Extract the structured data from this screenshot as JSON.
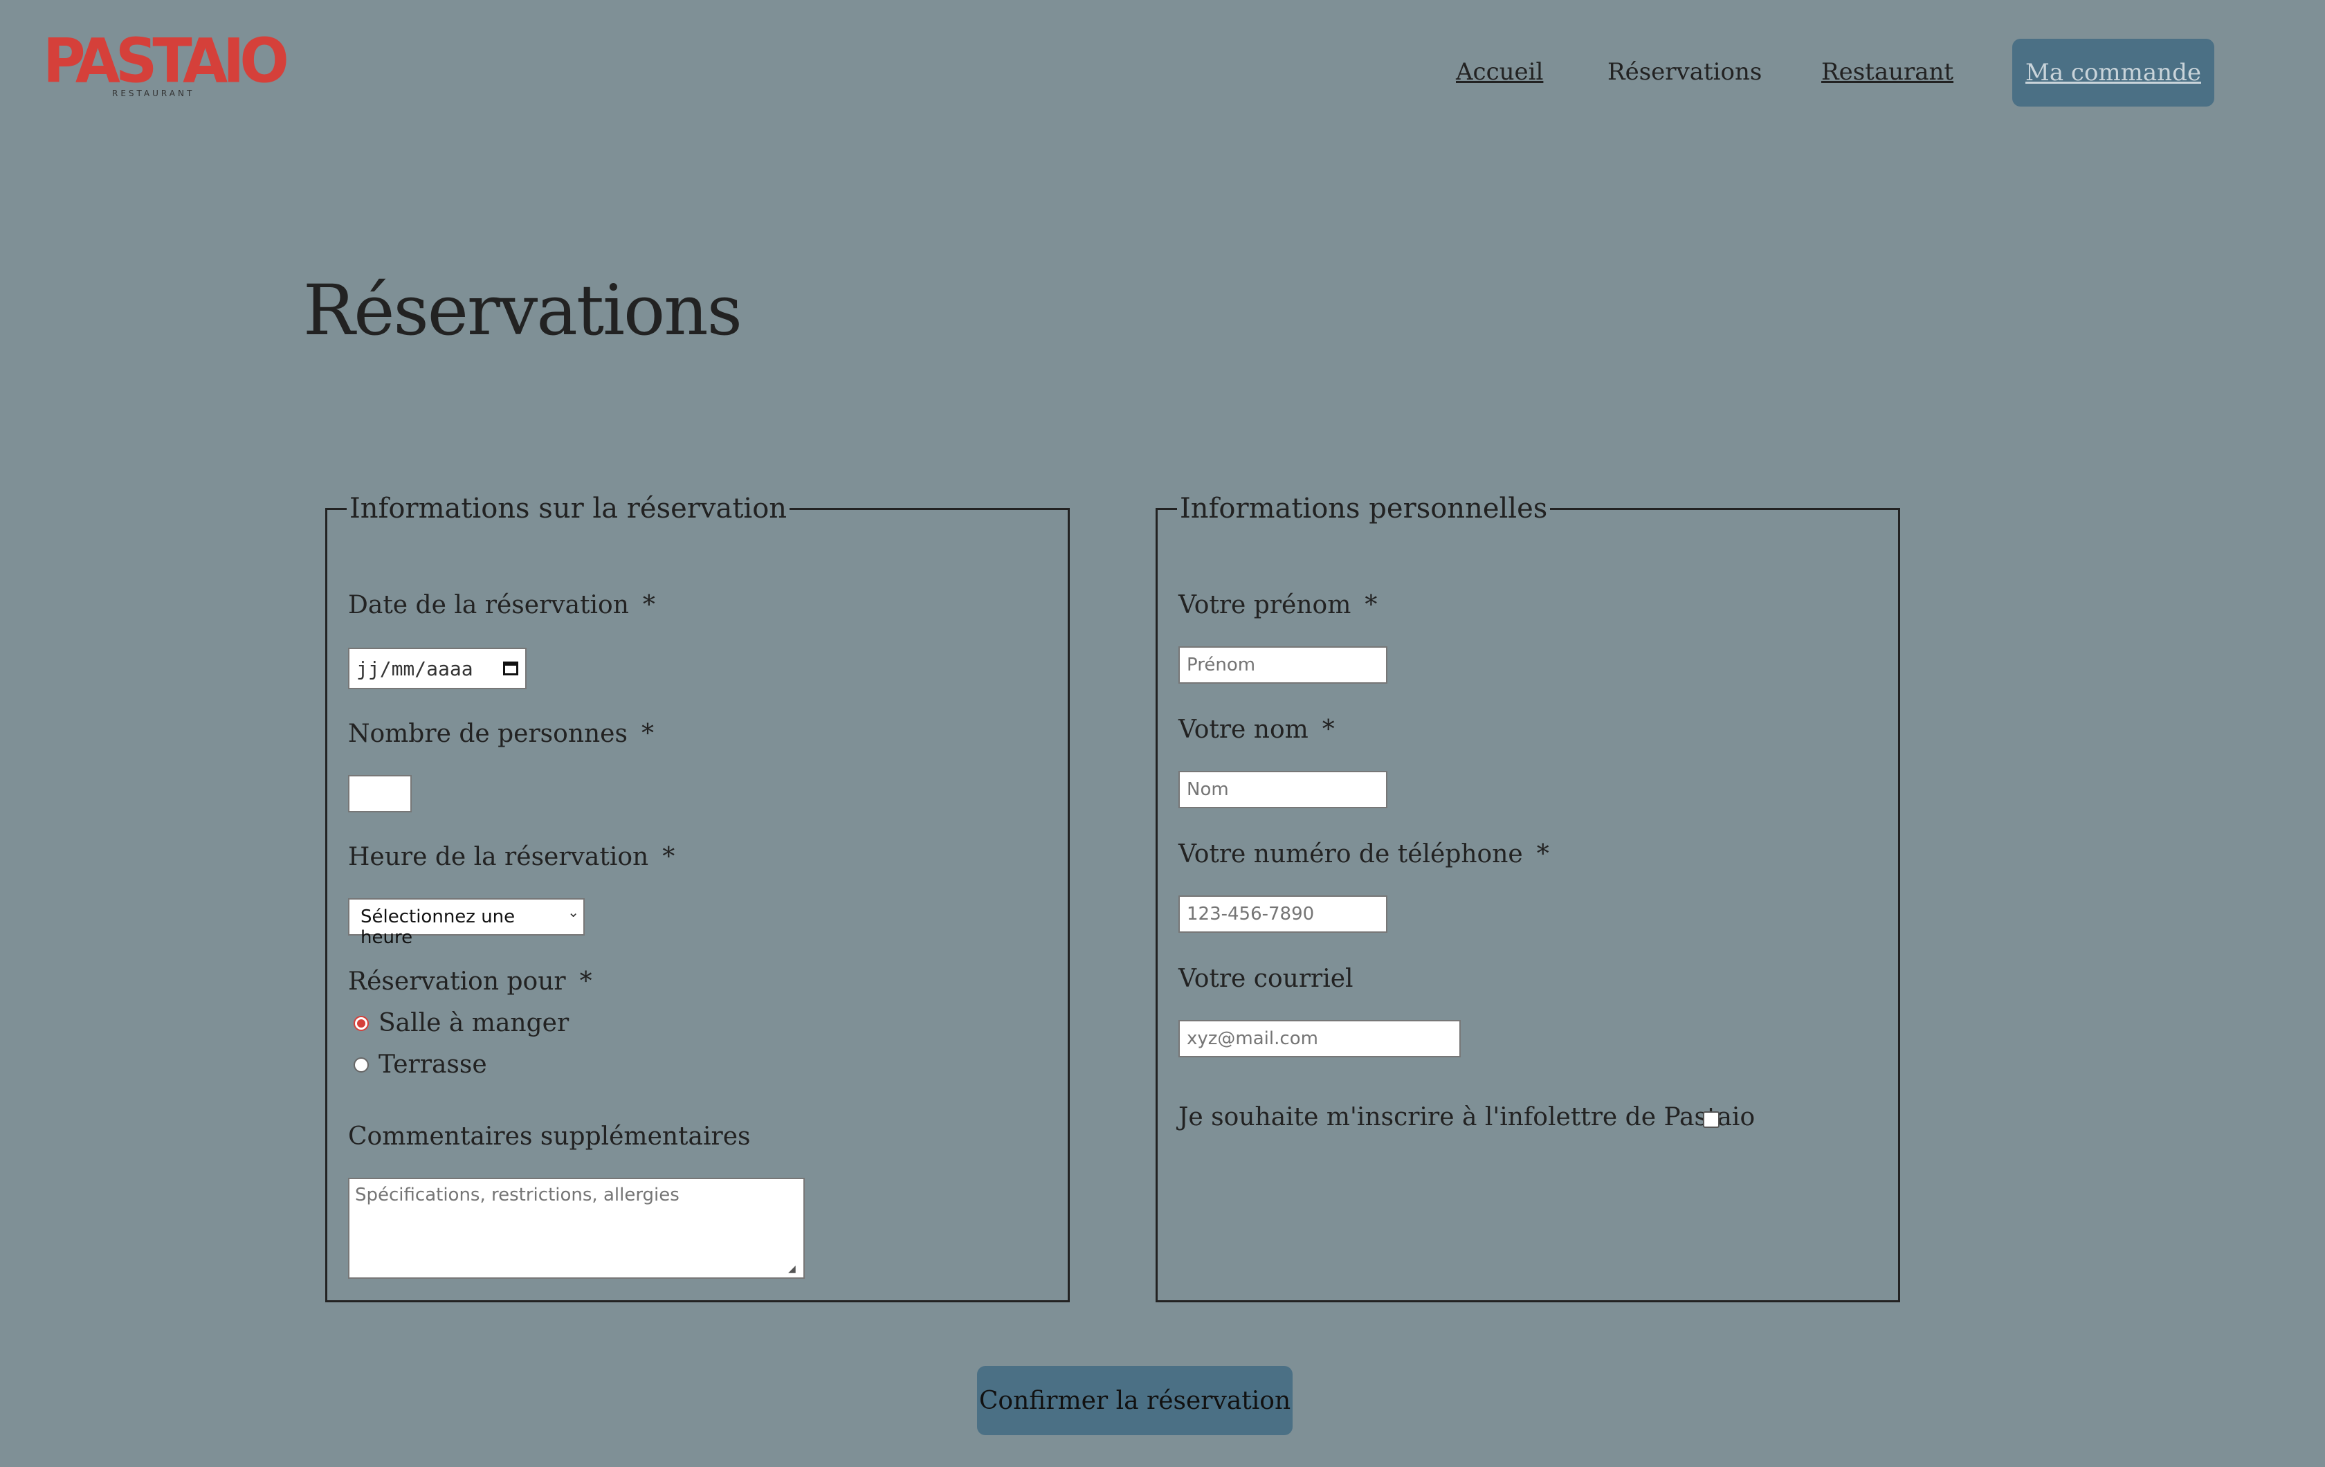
{
  "brand": {
    "logo_text": "PASTAIO",
    "logo_subtext": "RESTAURANT",
    "color": "#d5403a"
  },
  "nav": {
    "home": "Accueil",
    "reservations": "Réservations",
    "restaurant": "Restaurant",
    "order": "Ma commande"
  },
  "page": {
    "title": "Réservations"
  },
  "reservation": {
    "legend": "Informations sur la réservation",
    "date_label": "Date de la réservation",
    "date_placeholder": "jj/mm/aaaa",
    "people_label": "Nombre de personnes",
    "people_value": "",
    "time_label": "Heure de la réservation",
    "time_selected": "Sélectionnez une heure",
    "for_label": "Réservation pour",
    "options": [
      "Salle à manger",
      "Terrasse"
    ],
    "selected_option": "Salle à manger",
    "comments_label": "Commentaires supplémentaires",
    "comments_placeholder": "Spécifications, restrictions, allergies",
    "required_mark": "*"
  },
  "personal": {
    "legend": "Informations personnelles",
    "firstname_label": "Votre prénom",
    "firstname_placeholder": "Prénom",
    "lastname_label": "Votre nom",
    "lastname_placeholder": "Nom",
    "phone_label": "Votre numéro de téléphone",
    "phone_placeholder": "123-456-7890",
    "email_label": "Votre courriel",
    "email_placeholder": "xyz@mail.com",
    "newsletter_label": "Je souhaite m'inscrire à l'infolettre de Pastaio",
    "newsletter_checked": false,
    "required_mark": "*"
  },
  "submit": {
    "label": "Confirmer la réservation"
  },
  "colors": {
    "background": "#7f9096",
    "button": "#4b7085",
    "accent": "#d5403a"
  }
}
